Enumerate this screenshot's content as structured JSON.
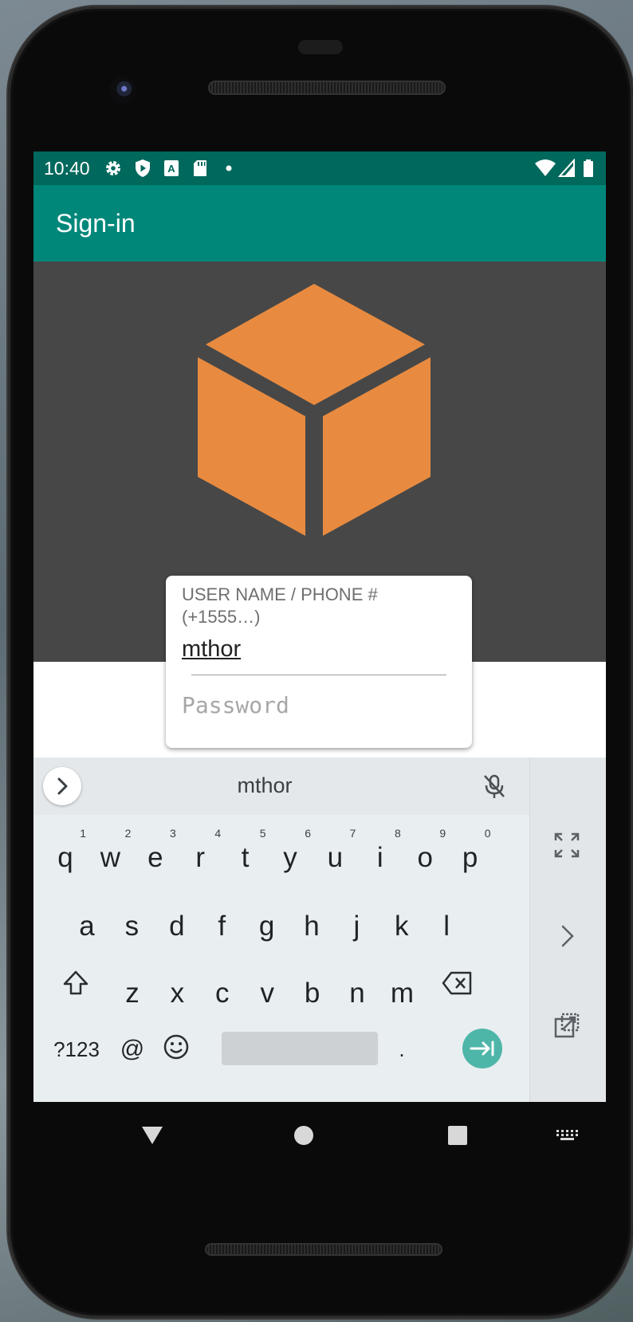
{
  "status_bar": {
    "time": "10:40"
  },
  "app_bar": {
    "title": "Sign-in"
  },
  "login": {
    "username_label": "USER NAME / PHONE # (+1555…)",
    "username_value": "mthor",
    "password_placeholder": "Password"
  },
  "keyboard": {
    "suggestion": "mthor",
    "row1": [
      {
        "k": "q",
        "h": "1"
      },
      {
        "k": "w",
        "h": "2"
      },
      {
        "k": "e",
        "h": "3"
      },
      {
        "k": "r",
        "h": "4"
      },
      {
        "k": "t",
        "h": "5"
      },
      {
        "k": "y",
        "h": "6"
      },
      {
        "k": "u",
        "h": "7"
      },
      {
        "k": "i",
        "h": "8"
      },
      {
        "k": "o",
        "h": "9"
      },
      {
        "k": "p",
        "h": "0"
      }
    ],
    "row2": [
      "a",
      "s",
      "d",
      "f",
      "g",
      "h",
      "j",
      "k",
      "l"
    ],
    "row3": [
      "z",
      "x",
      "c",
      "v",
      "b",
      "n",
      "m"
    ],
    "symbols_label": "?123",
    "at_label": "@",
    "period_label": "."
  },
  "colors": {
    "status_bar": "#00685c",
    "app_bar": "#00877a",
    "hero_background": "#474747",
    "logo": "#e88b40",
    "enter_key": "#4eb6a9"
  }
}
